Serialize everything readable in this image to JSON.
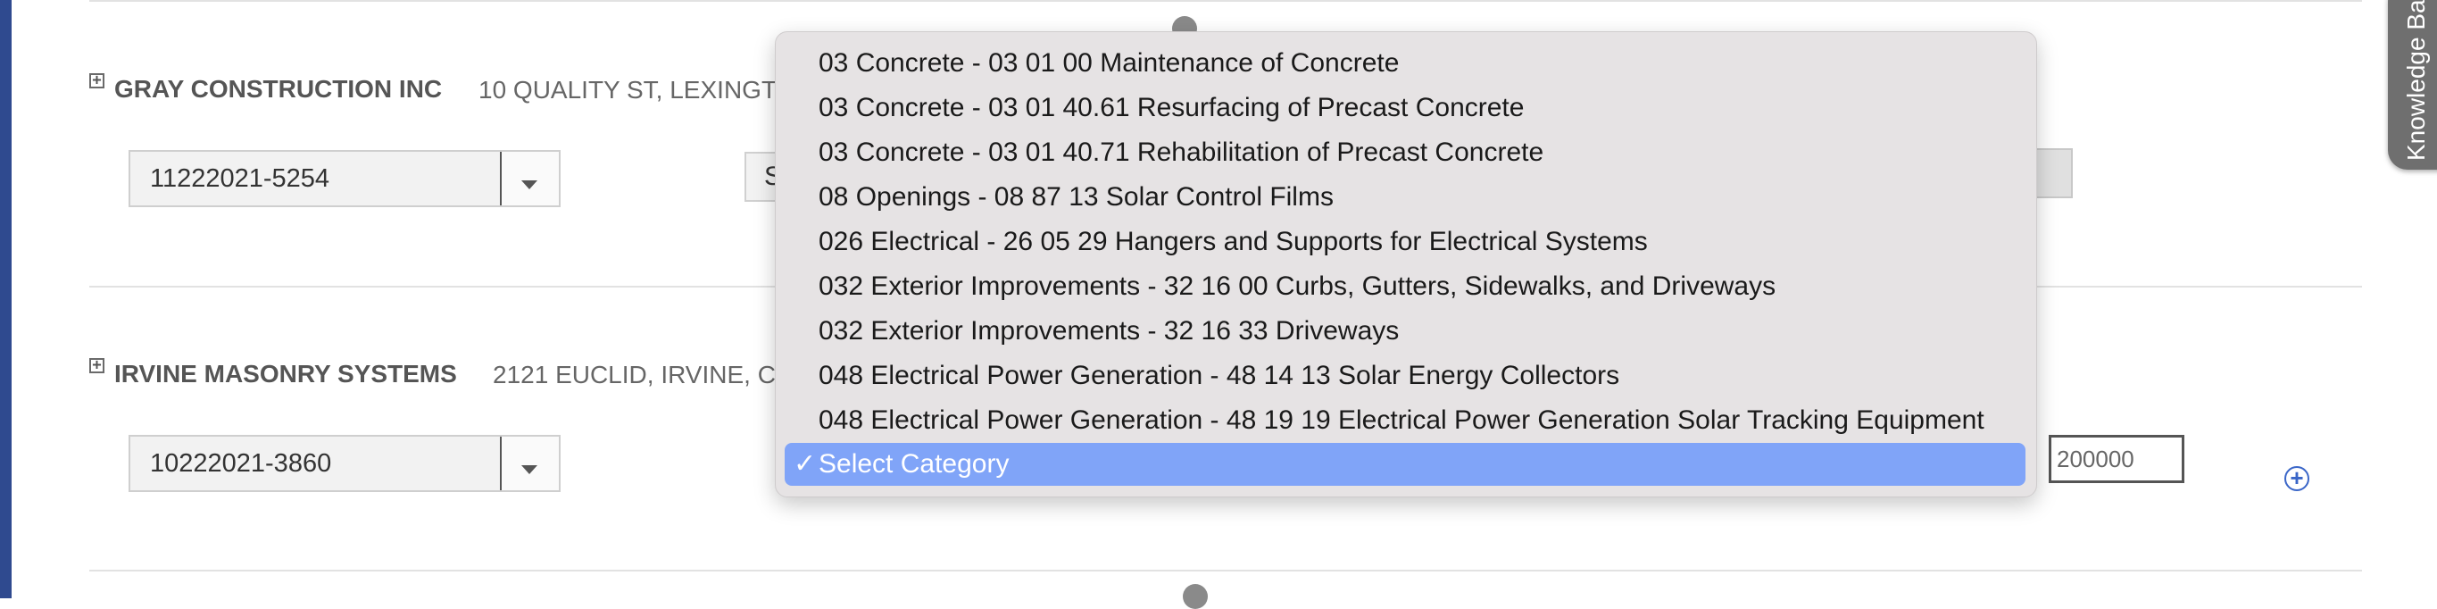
{
  "companies": [
    {
      "name": "GRAY CONSTRUCTION INC",
      "address": "10 QUALITY ST, LEXINGT",
      "permit": "11222021-5254",
      "category_peek": "S"
    },
    {
      "name": "IRVINE MASONRY SYSTEMS",
      "address": "2121 EUCLID, IRVINE, C",
      "permit": "10222021-3860",
      "amount": "200000"
    }
  ],
  "expand_symbol": "+",
  "add_symbol": "+",
  "knowledge_tab_label": "Knowledge Ba",
  "category_dropdown": {
    "options": [
      "03 Concrete - 03 01 00 Maintenance of Concrete",
      "03 Concrete - 03 01 40.61 Resurfacing of Precast Concrete",
      "03 Concrete - 03 01 40.71 Rehabilitation of Precast Concrete",
      "08 Openings - 08 87 13 Solar Control Films",
      "026 Electrical - 26 05 29 Hangers and Supports for Electrical Systems",
      "032 Exterior Improvements - 32 16 00 Curbs, Gutters, Sidewalks, and Driveways",
      "032 Exterior Improvements - 32 16 33 Driveways",
      "048 Electrical Power Generation - 48 14 13 Solar Energy Collectors",
      "048 Electrical Power Generation - 48 19 19 Electrical Power Generation Solar Tracking Equipment"
    ],
    "selected_check": "✓",
    "selected_label": "Select Category"
  },
  "colors": {
    "selection_highlight": "#80a4f8",
    "left_strip": "#2f4a8f",
    "add_icon": "#3a66c8"
  }
}
